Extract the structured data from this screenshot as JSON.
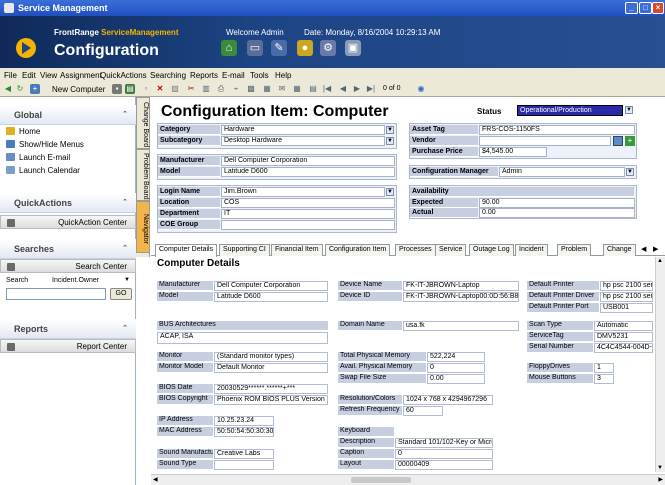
{
  "window": {
    "title": "Service Management"
  },
  "banner": {
    "brand_a": "FrontRange ",
    "brand_b": "ServiceManagement",
    "title": "Configuration",
    "welcome": "Welcome Admin",
    "date": "Date: Monday, 8/16/2004 10:29:13 AM"
  },
  "menu": [
    "File",
    "Edit",
    "View",
    "Assignment",
    "QuickActions",
    "Searching",
    "Reports",
    "E-mail",
    "Tools",
    "Help"
  ],
  "toolbar": {
    "new_label": "New Computer",
    "paging": "0 of 0"
  },
  "sidebar": {
    "global": {
      "title": "Global",
      "items": [
        "Home",
        "Show/Hide Menus",
        "Launch E-mail",
        "Launch Calendar"
      ]
    },
    "quickactions": {
      "title": "QuickActions",
      "bar": "QuickAction Center"
    },
    "searches": {
      "title": "Searches",
      "bar": "Search Center",
      "search_label": "Search",
      "search_value": "Incident.Owner",
      "go": "GO"
    },
    "reports": {
      "title": "Reports",
      "bar": "Report Center"
    }
  },
  "vtabs": [
    "Change Board",
    "Problem Board",
    "Navigator"
  ],
  "form": {
    "title": "Configuration Item: Computer",
    "status_label": "Status",
    "status_value": "Operational/Production",
    "category_label": "Category",
    "category": "Hardware",
    "subcategory_label": "Subcategory",
    "subcategory": "Desktop Hardware",
    "manufacturer_label": "Manufacturer",
    "manufacturer": "Dell Computer Corporation",
    "model_label": "Model",
    "model": "Latitude D600",
    "login_label": "Login Name",
    "login": "Jim.Brown",
    "location_label": "Location",
    "location": "COS",
    "department_label": "Department",
    "department": "IT",
    "coe_label": "COE Group",
    "coe": "",
    "asset_label": "Asset Tag",
    "asset": "FRS-COS-1150FS",
    "vendor_label": "Vendor",
    "vendor": "",
    "price_label": "Purchase Price",
    "price": "$4,545.00",
    "cm_label": "Configuration Manager",
    "cm": "Admin",
    "avail_label": "Availability",
    "expected_label": "Expected",
    "expected": "90.00",
    "actual_label": "Actual",
    "actual": "0.00"
  },
  "tabs": [
    "Computer Details",
    "Supporting CI",
    "Financial Item",
    "Configuration Item",
    "Processes",
    "Service",
    "Outage Log",
    "Incident",
    "Problem",
    "Change"
  ],
  "details": {
    "title": "Computer Details",
    "manufacturer_label": "Manufacturer",
    "manufacturer": "Dell Computer Corporation",
    "model_label": "Model",
    "model": "Latitude D600",
    "devname_label": "Device Name",
    "devname": "FK-IT-JBROWN-Laptop",
    "devid_label": "Device ID",
    "devid": "FK-IT-JBROWN-Laptop00:0D:56:B8:",
    "printer_label": "Default Printer",
    "printer": "hp psc 2100 seri",
    "driver_label": "Default Printer Driver",
    "driver": "hp psc 2100 seri",
    "port_label": "Default Printer Port",
    "port": "USB001",
    "bus_label": "BUS Architectures",
    "bus": "ACAP, ISA",
    "domain_label": "Domain Name",
    "domain": "usa.fk",
    "scan_label": "Scan Type",
    "scan": "Automatic",
    "stag_label": "ServiceTag",
    "stag": "DMV5231",
    "serial_label": "Serial Number",
    "serial": "4C4C4544-004D-",
    "monitor_label": "Monitor",
    "monitor": "(Standard monitor types)",
    "monmodel_label": "Monitor Model",
    "monmodel": "Default Monitor",
    "tpm_label": "Total Physical Memory",
    "tpm": "522,224",
    "apm_label": "Avail. Physical Memory",
    "apm": "0",
    "swap_label": "Swap File Size",
    "swap": "0.00",
    "floppy_label": "FloppyDrives",
    "floppy": "1",
    "mouse_label": "Mouse Buttons",
    "mouse": "3",
    "biosdate_label": "BIOS Date",
    "biosdate": "20030529******.******+***",
    "bioscopy_label": "BIOS Copyright",
    "bioscopy": "Phoenix ROM BIOS PLUS Version 1",
    "res_label": "Resolution/Colors",
    "res": "1024 x 768 x 4294967296",
    "refresh_label": "Refresh Frequency",
    "refresh": "60",
    "ip_label": "IP Address",
    "ip": "10.25.23.24",
    "mac_label": "MAC Address",
    "mac": "50:50:54:50:30:30",
    "kb_label": "Keyboard",
    "kb": "",
    "desc_label": "Description",
    "desc": "Standard 101/102-Key or Micros",
    "cap_label": "Caption",
    "cap": "0",
    "layout_label": "Layout",
    "layout": "00000409",
    "sm_label": "Sound Manufacturer",
    "sm": "Creative Labs",
    "st_label": "Sound Type",
    "st": ""
  }
}
